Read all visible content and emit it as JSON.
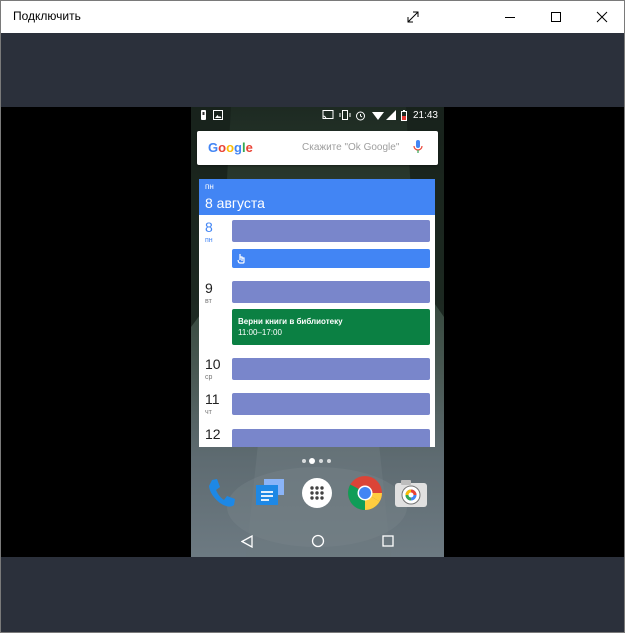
{
  "window": {
    "title": "Подключить",
    "controls": {
      "expand_icon": "expand-icon",
      "minimize_icon": "minimize-icon",
      "maximize_icon": "maximize-icon",
      "close_icon": "close-icon"
    }
  },
  "phone": {
    "status_bar": {
      "time": "21:43",
      "icons": [
        "notification-icon",
        "image-icon",
        "cast-icon",
        "vibrate-icon",
        "alarm-icon",
        "wifi-icon",
        "signal-icon",
        "battery-icon"
      ]
    },
    "search": {
      "logo": "Google",
      "hint": "Скажите \"Ok Google\"",
      "mic_icon": "mic-icon"
    },
    "calendar": {
      "header_dow": "пн",
      "header_date": "8 августа",
      "days": [
        {
          "num": "8",
          "dow": "пн"
        },
        {
          "num": "9",
          "dow": "вт"
        },
        {
          "num": "10",
          "dow": "ср"
        },
        {
          "num": "11",
          "dow": "чт"
        },
        {
          "num": "12",
          "dow": ""
        }
      ],
      "event_green": {
        "title": "Верни книги в библиотеку",
        "time": "11:00–17:00"
      },
      "colors": {
        "header": "#4285f4",
        "event_purple": "#7986cb",
        "event_blue": "#4285f4",
        "event_green": "#0b8043"
      }
    },
    "pager": {
      "count": 4,
      "current": 2
    },
    "dock": [
      "phone-app",
      "messages-app",
      "app-drawer",
      "chrome-app",
      "camera-app"
    ],
    "nav": [
      "back-button",
      "home-button",
      "recents-button"
    ]
  }
}
